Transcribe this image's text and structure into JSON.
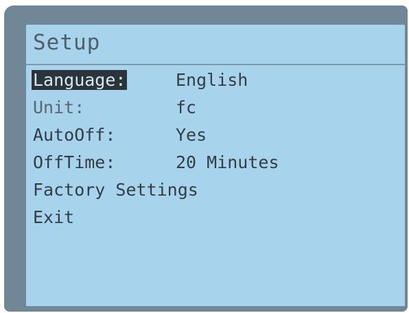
{
  "screen": {
    "title": "Setup"
  },
  "menu": {
    "items": [
      {
        "label": "Language:",
        "value": "English"
      },
      {
        "label": "Unit:",
        "value": "fc"
      },
      {
        "label": "AutoOff:",
        "value": "Yes"
      },
      {
        "label": "OffTime:",
        "value": "20 Minutes"
      },
      {
        "label": "Factory Settings",
        "value": ""
      },
      {
        "label": "Exit",
        "value": ""
      }
    ],
    "selected_index": 0
  },
  "colors": {
    "lcd_background": "#a8d3ec",
    "bezel": "#6f8796",
    "text": "#333d44",
    "highlight": "#2b343a"
  }
}
